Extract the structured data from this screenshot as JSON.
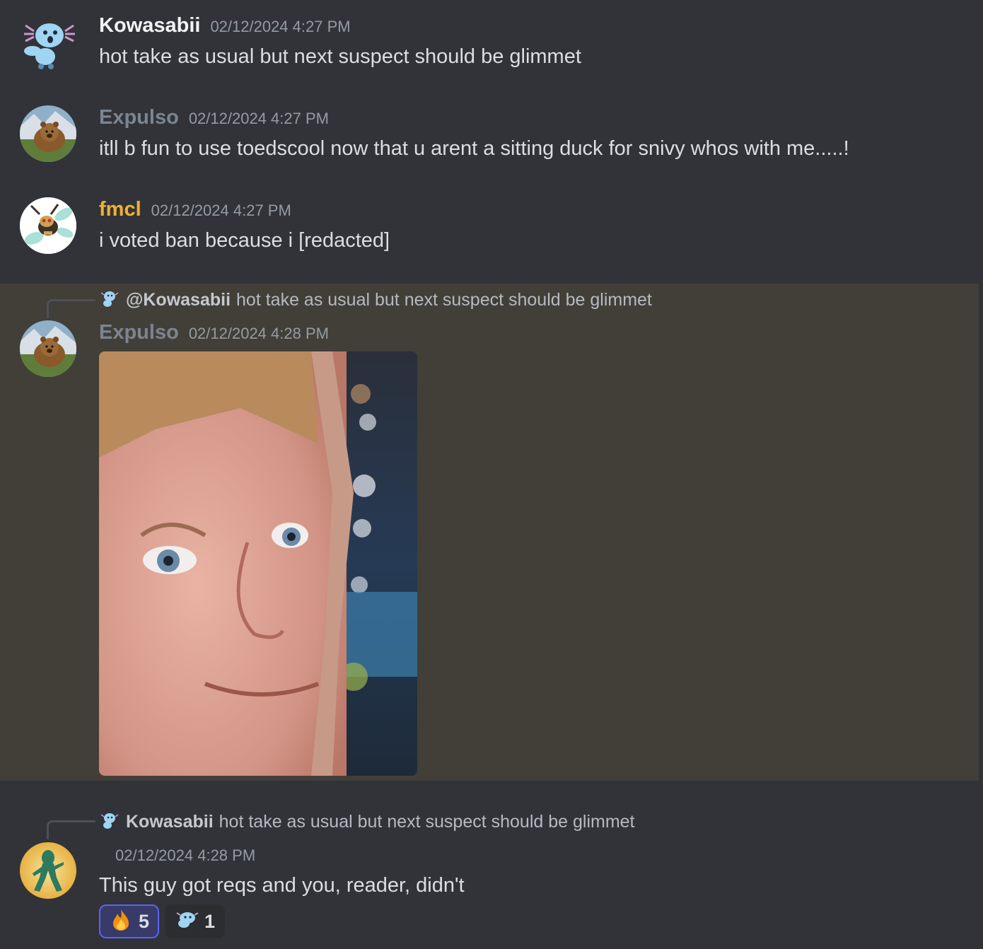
{
  "colors": {
    "kowasabii": "#f2f3f5",
    "expulso": "#7b8591",
    "fmcl": "#f0b132",
    "bob": "#f2f3f5",
    "highlight_bg": "#423f38",
    "reaction_active_border": "#5865f2"
  },
  "messages": [
    {
      "username": "Kowasabii",
      "timestamp": "02/12/2024 4:27 PM",
      "text": "hot take as usual but next suspect should be glimmet",
      "avatar_icon": "wooper-avatar-icon"
    },
    {
      "username": "Expulso",
      "timestamp": "02/12/2024 4:27 PM",
      "text": "itll b fun to use toedscool now that u arent a sitting duck for snivy whos with me.....!",
      "avatar_icon": "bear-avatar-icon"
    },
    {
      "username": "fmcl",
      "timestamp": "02/12/2024 4:27 PM",
      "text": "i voted ban because i [redacted]",
      "avatar_icon": "ninjask-avatar-icon"
    },
    {
      "reply_user": "@Kowasabii",
      "reply_text": "hot take as usual but next suspect should be glimmet",
      "username": "Expulso",
      "timestamp": "02/12/2024 4:28 PM",
      "attachment_icon": "blinking-guy-gif",
      "avatar_icon": "bear-avatar-icon"
    },
    {
      "reply_user": "Kowasabii",
      "reply_text": "hot take as usual but next suspect should be glimmet",
      "timestamp": "02/12/2024 4:28 PM",
      "text": "This guy got reqs and you, reader, didn't",
      "avatar_icon": "bold-and-brash-avatar-icon",
      "reactions": [
        {
          "emoji_icon": "fire-emoji-icon",
          "count": "5",
          "active": true
        },
        {
          "emoji_icon": "wooper-emoji-icon",
          "count": "1",
          "active": false
        }
      ]
    }
  ]
}
